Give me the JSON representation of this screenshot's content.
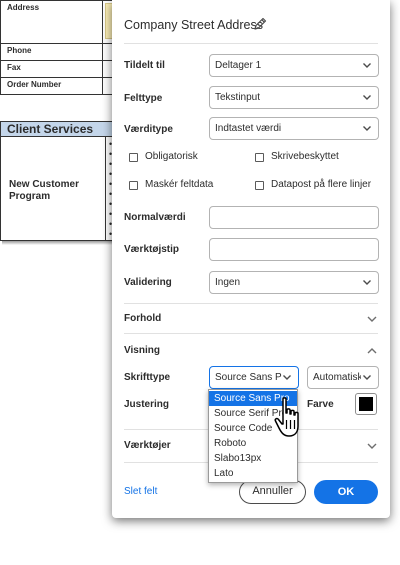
{
  "document": {
    "rows": [
      "Address",
      "Phone",
      "Fax",
      "Order Number"
    ],
    "section_header": "Client Services",
    "section_label": "New Customer Program",
    "bullets": [
      "•",
      "•",
      "•",
      "•",
      "•",
      "•",
      "•",
      "•",
      "•",
      "•"
    ]
  },
  "panel": {
    "title": "Company Street Address",
    "fields": {
      "assigned_to": {
        "label": "Tildelt til",
        "value": "Deltager 1"
      },
      "field_type": {
        "label": "Felttype",
        "value": "Tekstinput"
      },
      "value_type": {
        "label": "Værditype",
        "value": "Indtastet værdi"
      },
      "default_value": {
        "label": "Normalværdi",
        "value": ""
      },
      "tooltip": {
        "label": "Værktøjstip",
        "value": ""
      },
      "validation": {
        "label": "Validering",
        "value": "Ingen"
      }
    },
    "checkboxes": {
      "required": "Obligatorisk",
      "readonly": "Skrivebeskyttet",
      "mask": "Maskér feltdata",
      "multiline": "Datapost på flere linjer"
    },
    "sections": {
      "conditions": "Forhold",
      "display": "Visning",
      "tools": "Værktøjer"
    },
    "display": {
      "font_label": "Skrifttype",
      "font_value": "Source Sans P",
      "size_value": "Automatisk",
      "align_label": "Justering",
      "color_label": "Farve",
      "color": "#000000"
    },
    "font_options": [
      "Source Sans Pro",
      "Source Serif Pro",
      "Source Code",
      "Roboto",
      "Slabo13px",
      "Lato"
    ],
    "font_selected_index": 0,
    "delete_label": "Slet felt",
    "cancel_label": "Annuller",
    "ok_label": "OK"
  },
  "colors": {
    "accent": "#1473e6",
    "section_header_bg": "#c4d6ea",
    "address_field_bg": "#fbeeb6"
  }
}
